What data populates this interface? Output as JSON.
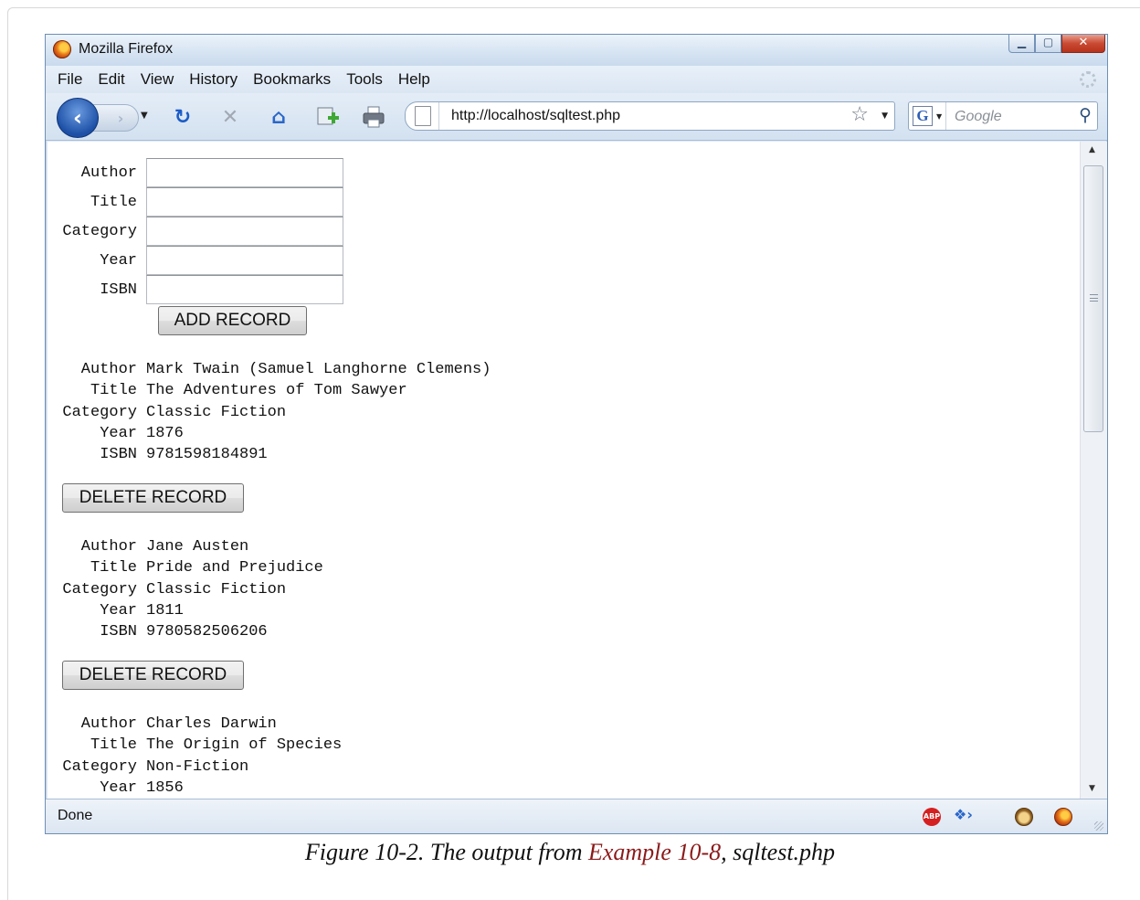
{
  "window": {
    "title": "Mozilla Firefox"
  },
  "menu": [
    "File",
    "Edit",
    "View",
    "History",
    "Bookmarks",
    "Tools",
    "Help"
  ],
  "toolbar": {
    "url": "http://localhost/sqltest.php",
    "search_placeholder": "Google",
    "search_engine_glyph": "G"
  },
  "form": {
    "fields": [
      {
        "label": "Author",
        "value": ""
      },
      {
        "label": "Title",
        "value": ""
      },
      {
        "label": "Category",
        "value": ""
      },
      {
        "label": "Year",
        "value": ""
      },
      {
        "label": "ISBN",
        "value": ""
      }
    ],
    "submit_label": "ADD RECORD"
  },
  "records": [
    {
      "fields": [
        {
          "label": "Author",
          "value": "Mark Twain (Samuel Langhorne Clemens)"
        },
        {
          "label": "Title",
          "value": "The Adventures of Tom Sawyer"
        },
        {
          "label": "Category",
          "value": "Classic Fiction"
        },
        {
          "label": "Year",
          "value": "1876"
        },
        {
          "label": "ISBN",
          "value": "9781598184891"
        }
      ],
      "delete_label": "DELETE RECORD"
    },
    {
      "fields": [
        {
          "label": "Author",
          "value": "Jane Austen"
        },
        {
          "label": "Title",
          "value": "Pride and Prejudice"
        },
        {
          "label": "Category",
          "value": "Classic Fiction"
        },
        {
          "label": "Year",
          "value": "1811"
        },
        {
          "label": "ISBN",
          "value": "9780582506206"
        }
      ],
      "delete_label": "DELETE RECORD"
    },
    {
      "fields": [
        {
          "label": "Author",
          "value": "Charles Darwin"
        },
        {
          "label": "Title",
          "value": "The Origin of Species"
        },
        {
          "label": "Category",
          "value": "Non-Fiction"
        },
        {
          "label": "Year",
          "value": "1856"
        }
      ]
    }
  ],
  "status": {
    "text": "Done",
    "adblock_badge": "ABP"
  },
  "caption": {
    "prefix": "Figure 10-2. The output from ",
    "link": "Example 10-8",
    "suffix": ", sqltest.php"
  },
  "colors": {
    "caption_link": "#8b1a1a",
    "titlebar": "#d5e3f2",
    "back_button": "#1d4fa6"
  },
  "icons": {
    "back": "back-arrow-icon",
    "forward": "forward-arrow-icon",
    "reload": "reload-icon",
    "stop": "stop-icon",
    "home": "home-icon",
    "new_tab": "new-tab-icon",
    "print": "print-icon",
    "bookmark": "star-icon",
    "search": "magnifier-icon"
  }
}
